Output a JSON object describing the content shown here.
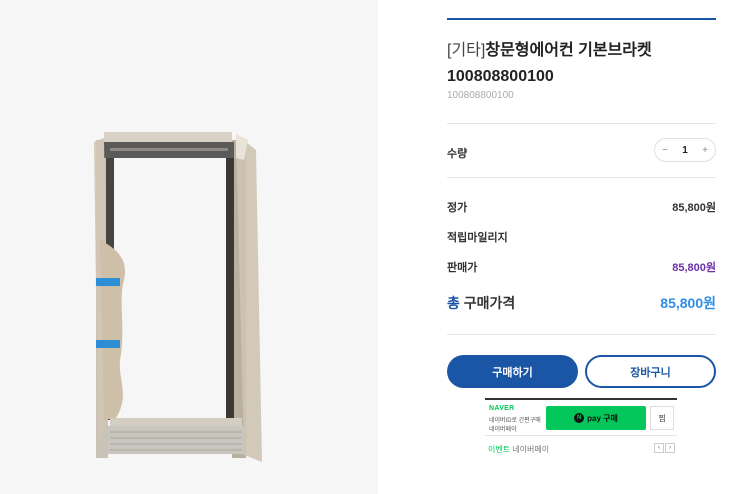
{
  "product": {
    "title_prefix": "[기타]",
    "title_main": "창문형에어컨 기본브라켓",
    "title_code": "100808800100",
    "code": "100808800100"
  },
  "quantity": {
    "label": "수량",
    "minus": "−",
    "value": "1",
    "plus": "+"
  },
  "prices": {
    "list_label": "정가",
    "list_value": "85,800원",
    "mileage_label": "적립마일리지",
    "sale_label": "판매가",
    "sale_value": "85,800원",
    "total_label_first": "총",
    "total_label_rest": " 구매가격",
    "total_value": "85,800원"
  },
  "actions": {
    "buy": "구매하기",
    "cart": "장바구니"
  },
  "npay": {
    "brand": "NAVER",
    "sub1": "네이버ID로 간편구매",
    "sub2": "네이버페이",
    "button_n": "N",
    "button": "pay 구매",
    "wish": "찜",
    "event_highlight": "이벤트",
    "event_rest": " 네이버페이",
    "prev": "‹",
    "next": "›"
  },
  "colors": {
    "brand_blue": "#1a56a5",
    "total_blue": "#2f8fe8",
    "sale_purple": "#6a2fa6",
    "npay_green": "#03c75a"
  }
}
